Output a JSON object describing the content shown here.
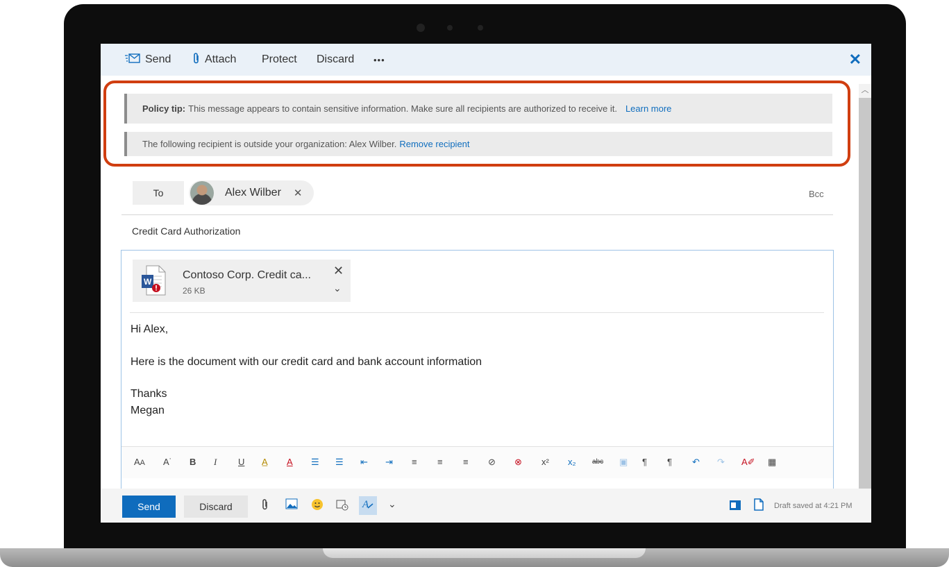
{
  "toolbar": {
    "send": "Send",
    "attach": "Attach",
    "protect": "Protect",
    "discard": "Discard",
    "more": "•••",
    "close": "✕"
  },
  "policy_tip": {
    "label": "Policy tip:",
    "text": "This message appears to contain sensitive information. Make sure all recipients are authorized to receive it.",
    "link": "Learn more"
  },
  "external_warning": {
    "text": "The following recipient is outside your organization: Alex Wilber.",
    "link": "Remove recipient"
  },
  "recipients": {
    "to_label": "To",
    "name": "Alex Wilber",
    "remove": "✕",
    "bcc": "Bcc"
  },
  "subject": "Credit Card Authorization",
  "attachment": {
    "name": "Contoso Corp. Credit ca...",
    "size": "26 KB",
    "badge": "W"
  },
  "message": {
    "greeting": "Hi Alex,",
    "line1": "Here is the document with our credit card and bank account information",
    "closing": "Thanks",
    "signature": "Megan"
  },
  "footer": {
    "send": "Send",
    "discard": "Discard",
    "draft_status": "Draft saved at 4:21 PM"
  },
  "colors": {
    "accent": "#0f6cbd",
    "highlight": "#d03e10"
  }
}
